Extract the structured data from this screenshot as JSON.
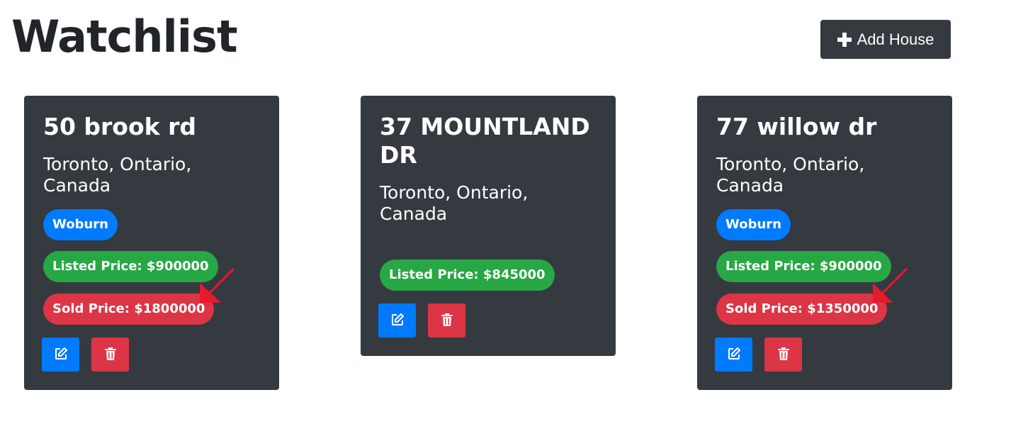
{
  "header": {
    "title": "Watchlist",
    "add_button_label": "Add House"
  },
  "houses": [
    {
      "address": "50 brook rd",
      "location": "Toronto, Ontario, Canada",
      "neighbourhood": "Woburn",
      "listed_price": "Listed Price: $900000",
      "sold_price": "Sold Price: $1800000"
    },
    {
      "address": "37 MOUNTLAND DR",
      "location": "Toronto, Ontario, Canada",
      "listed_price": "Listed Price: $845000"
    },
    {
      "address": "77 willow dr",
      "location": "Toronto, Ontario, Canada",
      "neighbourhood": "Woburn",
      "listed_price": "Listed Price: $900000",
      "sold_price": "Sold Price: $1350000"
    }
  ],
  "icons": {
    "add": "plus-icon",
    "edit": "edit-icon",
    "delete": "trash-icon",
    "annotation": "red-arrow-icon"
  },
  "colors": {
    "card_bg": "#343a40",
    "primary": "#007bff",
    "success": "#28a745",
    "danger": "#dc3545",
    "annotation_arrow": "#e8192c"
  }
}
